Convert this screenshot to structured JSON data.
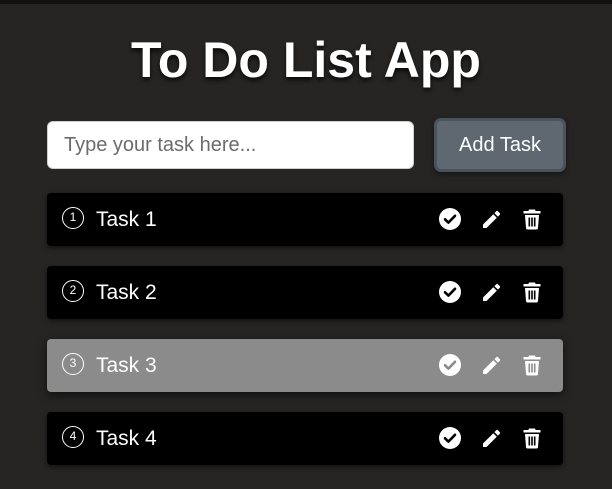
{
  "app": {
    "title": "To Do List App"
  },
  "input": {
    "value": "",
    "placeholder": "Type your task here..."
  },
  "add_button": {
    "label": "Add Task"
  },
  "tasks": [
    {
      "number": "1",
      "label": "Task 1",
      "highlighted": false
    },
    {
      "number": "2",
      "label": "Task 2",
      "highlighted": false
    },
    {
      "number": "3",
      "label": "Task 3",
      "highlighted": true
    },
    {
      "number": "4",
      "label": "Task 4",
      "highlighted": false
    }
  ],
  "row_actions": [
    {
      "icon": "check-circle-icon"
    },
    {
      "icon": "pencil-icon"
    },
    {
      "icon": "trash-icon"
    }
  ],
  "colors": {
    "background": "#262524",
    "row": "#000000",
    "row_highlighted": "#8b8b8b",
    "button": "#5f6770",
    "text": "#ffffff"
  }
}
